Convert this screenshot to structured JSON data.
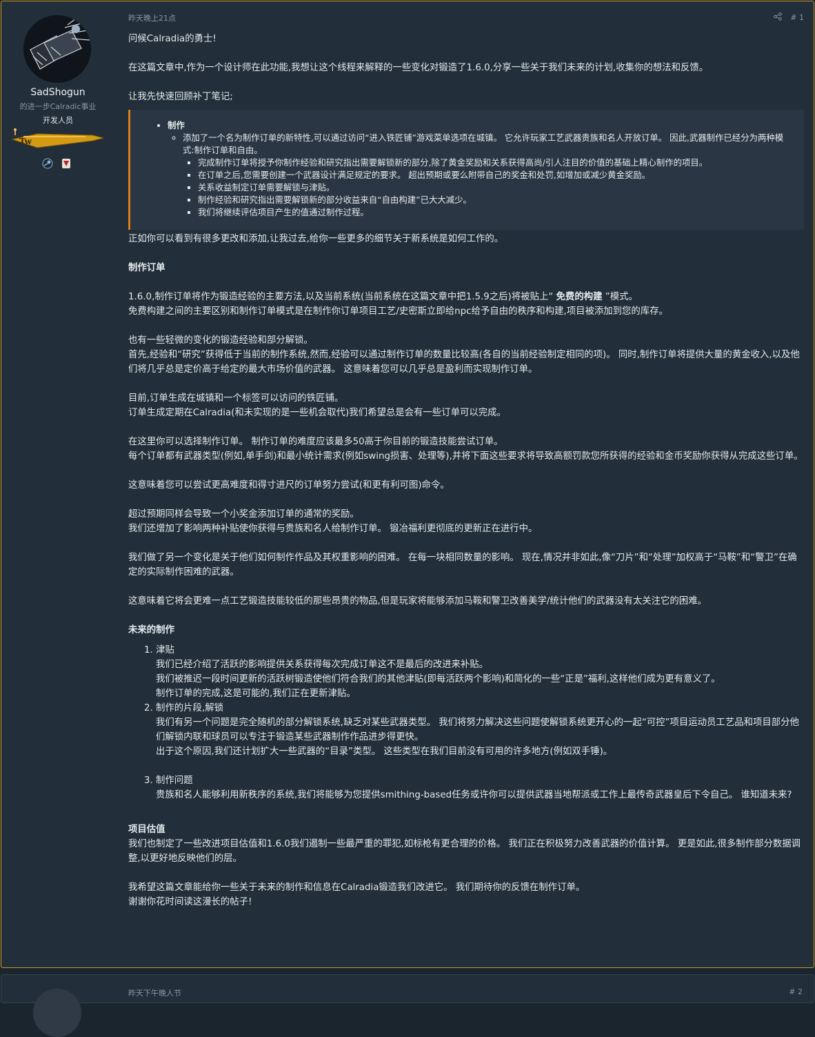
{
  "post": {
    "timestamp": "昨天晚上21点",
    "share_icon": "share-icon",
    "post_number": "# 1",
    "author": {
      "name": "SadShogun",
      "title": "的进一步Calradic事业",
      "role": "开发人员",
      "banner_text": "TW",
      "badges": [
        "steam-icon",
        "taleworlds-icon"
      ]
    },
    "greeting": "问候Calradia的勇士!",
    "intro": "在这篇文章中,作为一个设计师在此功能,我想让这个线程来解释的一些变化对锻造了1.6.0,分享一些关于我们未来的计划,收集你的想法和反馈。",
    "patch_intro": "让我先快速回顾补丁笔记;",
    "quote": {
      "heading": "制作",
      "item": "添加了一个名为制作订单的新特性,可以通过访问“进入铁匠铺”游戏菜单选项在城镇。 它允许玩家工艺武器贵族和名人开放订单。 因此,武器制作已经分为两种模式:制作订单和自由。",
      "subitems": [
        "完成制作订单将授予你制作经验和研究指出需要解锁新的部分,除了黄金奖励和关系获得高尚/引人注目的价值的基础上精心制作的项目。",
        "在订单之后,您需要创建一个武器设计满足规定的要求。 超出预期或要么附带自己的奖金和处罚,如增加或减少黄金奖励。",
        "关系收益制定订单需要解锁与津贴。",
        "制作经验和研究指出需要解锁新的部分收益来自“自由构建”已大大减少。",
        "我们将继续评估项目产生的值通过制作过程。"
      ]
    },
    "p_after_quote": "正如你可以看到有很多更改和添加,让我过去,给你一些更多的细节关于新系统是如何工作的。",
    "h_orders": "制作订单",
    "orders_l1_a": "1.6.0,制作订单将作为锻造经验的主要方法,以及当前系统(当前系统在这篇文章中把1.5.9之后)将被贴上“",
    "orders_l1_bold": "免费的构建",
    "orders_l1_b": "”模式。",
    "orders_l2": "免费构建之间的主要区别和制作订单模式是在制作你订单项目工艺/史密斯立即给npc给予自由的秩序和构建,项目被添加到您的库存。",
    "p3_l1": "也有一些轻微的变化的锻造经验和部分解锁。",
    "p3_l2": "首先,经验和“研究”获得低于当前的制作系统,然而,经验可以通过制作订单的数量比较高(各自的当前经验制定相同的项)。 同时,制作订单将提供大量的黄金收入,以及他们将几乎总是定价高于给定的最大市场价值的武器。 这意味着您可以几乎总是盈利而实现制作订单。",
    "p4_l1": "目前,订单生成在城镇和一个标签可以访问的铁匠铺。",
    "p4_l2": "订单生成定期在Calradia(和未实现的是一些机会取代)我们希望总是会有一些订单可以完成。",
    "p5_l1": "在这里你可以选择制作订单。 制作订单的难度应该最多50高于你目前的锻造技能尝试订单。",
    "p5_l2": "每个订单都有武器类型(例如,单手剑)和最小统计需求(例如swing损害、处理等),并将下面这些要求将导致高额罚款您所获得的经验和金币奖励你获得从完成这些订单。",
    "p6": "这意味着您可以尝试更高难度和得寸进尺的订单努力尝试(和更有利可图)命令。",
    "p7_l1": "超过预期同样会导致一个小奖金添加订单的通常的奖励。",
    "p7_l2": "我们还增加了影响两种补贴使你获得与贵族和名人给制作订单。 锻冶福利更彻底的更新正在进行中。",
    "p8": "我们做了另一个变化是关于他们如何制作作品及其权重影响的困难。 在每一块相同数量的影响。 现在,情况并非如此,像“刀片”和“处理”加权高于“马鞍”和“警卫”在确定的实际制作困难的武器。",
    "p9": "这意味着它将会更难一点工艺锻造技能较低的那些昂贵的物品,但是玩家将能够添加马鞍和警卫改善美学/统计他们的武器没有太关注它的困难。",
    "h_future": "未来的制作",
    "future": [
      {
        "title": "津贴",
        "lines": [
          "我们已经介绍了活跃的影响提供关系获得每次完成订单这不是最后的改进来补贴。",
          "我们被推迟一段时间更新的活跃树锻造使他们符合我们的其他津贴(即每活跃两个影响)和简化的一些“正是”福利,这样他们成为更有意义了。",
          "制作订单的完成,这是可能的,我们正在更新津贴。"
        ]
      },
      {
        "title": "制作的片段,解锁",
        "lines": [
          "我们有另一个问题是完全随机的部分解锁系统,缺乏对某些武器类型。 我们将努力解决这些问题使解锁系统更开心的一起“可控”项目运动员工艺品和项目部分他们解锁内联和球员可以专注于锻造某些武器制作作品进步得更快。",
          "出于这个原因,我们还计划扩大一些武器的“目录”类型。 这些类型在我们目前没有可用的许多地方(例如双手锤)。"
        ]
      },
      {
        "title": "制作问题",
        "lines": [
          "贵族和名人能够利用新秩序的系统,我们将能够为您提供smithing-based任务或许你可以提供武器当地帮派或工作上最传奇武器皇后下令自己。 谁知道未来?"
        ]
      }
    ],
    "h_value": "项目估值",
    "value_text": "我们也制定了一些改进项目估值和1.6.0我们遏制一些最严重的罪犯,如标枪有更合理的价格。 我们正在积极努力改善武器的价值计算。 更是如此,很多制作部分数据调整,以更好地反映他们的层。",
    "closing_l1": "我希望这篇文章能给你一些关于未来的制作和信息在Calradia锻造我们改进它。 我们期待你的反馈在制作订单。",
    "closing_l2": "谢谢你花时间读这漫长的帖子!"
  },
  "next_post": {
    "timestamp": "昨天下午晚人节",
    "post_number": "# 2"
  },
  "colors": {
    "background": "#1b252e",
    "post_bg": "#222e39",
    "post_border": "#c99a2b",
    "quote_bg": "#2a3643",
    "quote_accent": "#d97d16"
  }
}
